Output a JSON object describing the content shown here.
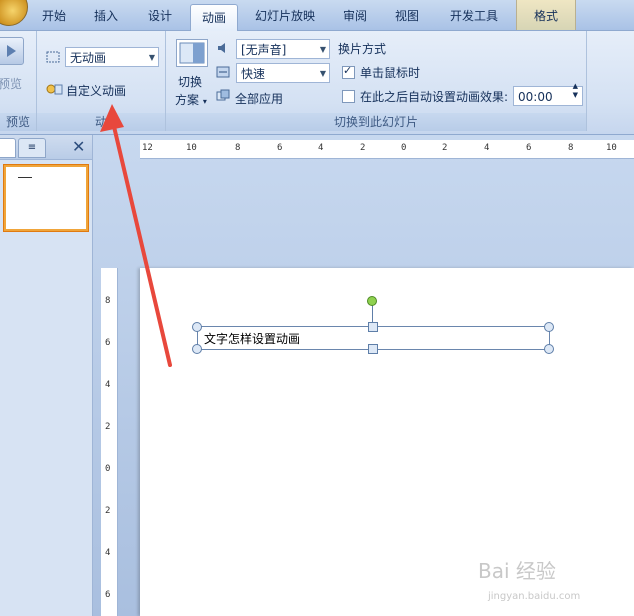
{
  "tabs": [
    "开始",
    "插入",
    "设计",
    "动画",
    "幻灯片放映",
    "审阅",
    "视图",
    "开发工具",
    "格式"
  ],
  "active_tab": "动画",
  "preview_group": {
    "button_label": "预览",
    "group_label": "预览"
  },
  "animation_group": {
    "animation_select": "无动画",
    "custom_animation_label": "自定义动画",
    "group_label": "动"
  },
  "transition_group": {
    "scheme_label_1": "切换",
    "scheme_label_2": "方案",
    "sound_select": "[无声音]",
    "speed_select": "快速",
    "apply_all_label": "全部应用",
    "advance_heading": "换片方式",
    "on_click_label": "单击鼠标时",
    "on_click_checked": true,
    "auto_after_label": "在此之后自动设置动画效果:",
    "auto_after_checked": false,
    "auto_after_time": "00:00",
    "group_label": "切换到此幻灯片"
  },
  "slide": {
    "textbox_text": "文字怎样设置动画"
  },
  "annotation_color": "#e8483c",
  "watermark": {
    "main": "Bai 经验",
    "sub": "jingyan.baidu.com"
  }
}
